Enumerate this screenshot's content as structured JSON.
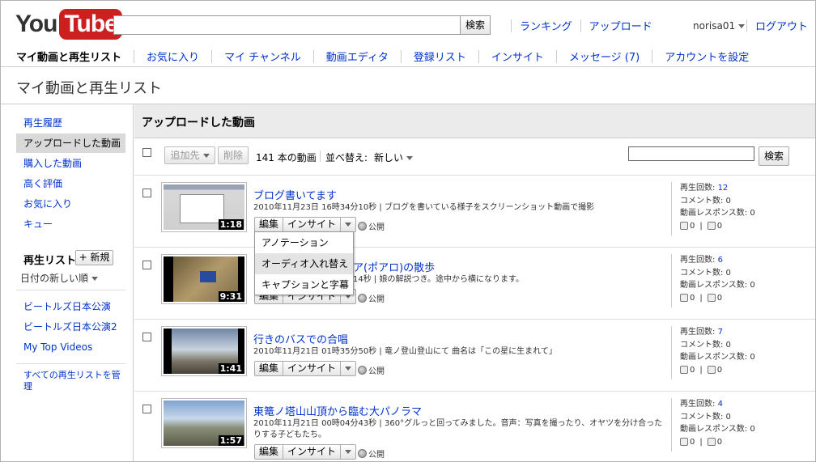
{
  "header": {
    "logo_you": "You",
    "logo_tube": "Tube",
    "search_button": "検索",
    "nav": [
      "ランキング",
      "アップロード"
    ],
    "username": "norisa01",
    "logout": "ログアウト"
  },
  "subnav": [
    "マイ動画と再生リスト",
    "お気に入り",
    "マイ チャンネル",
    "動画エディタ",
    "登録リスト",
    "インサイト",
    "メッセージ (7)",
    "アカウントを設定"
  ],
  "page_title": "マイ動画と再生リスト",
  "sidebar": {
    "items": [
      "再生履歴",
      "アップロードした動画",
      "購入した動画",
      "高く評価",
      "お気に入り",
      "キュー"
    ],
    "playlists_heading": "再生リスト",
    "new_button": "+ 新規",
    "sort": "日付の新しい順",
    "playlists": [
      "ビートルズ日本公演",
      "ビートルズ日本公演2",
      "My Top Videos"
    ],
    "manage_all": "すべての再生リストを管理"
  },
  "main": {
    "heading": "アップロードした動画",
    "add_to": "追加先",
    "delete": "削除",
    "count": "141 本の動画",
    "sort_label": "並べ替え:",
    "sort_value": "新しい",
    "search_button": "検索",
    "edit": "編集",
    "insight": "インサイト",
    "public": "公開",
    "stat_views": "再生回数: ",
    "stat_comments": "コメント数: 0",
    "stat_responses": "動画レスポンス数: 0",
    "likes": "0",
    "dislikes": "0",
    "videos": [
      {
        "title": "ブログ書いてます",
        "meta": "2010年11月23日 16時34分10秒 | ブログを書いている様子をスクリーンショット動画で撮影",
        "duration": "1:18",
        "views": "12"
      },
      {
        "title": "ア(ポアロ)の散歩",
        "meta": "14秒 | 娘の解説つき。途中から横になります。",
        "duration": "9:31",
        "views": "6"
      },
      {
        "title": "行きのバスでの合唱",
        "meta": "2010年11月21日 01時35分50秒 | 竜ノ登山登山にて 曲名は「この星に生まれて」",
        "duration": "1:41",
        "views": "7"
      },
      {
        "title": "東篭ノ塔山山頂から臨む大パノラマ",
        "meta": "2010年11月21日 00時04分43秒 | 360°グルっと回ってみました。音声：写真を撮ったり、オヤツを分け合ったりする子どもたち。",
        "duration": "1:57",
        "views": "4"
      }
    ]
  },
  "popup_menu": [
    "アノテーション",
    "オーディオ入れ替え",
    "キャプションと字幕"
  ]
}
